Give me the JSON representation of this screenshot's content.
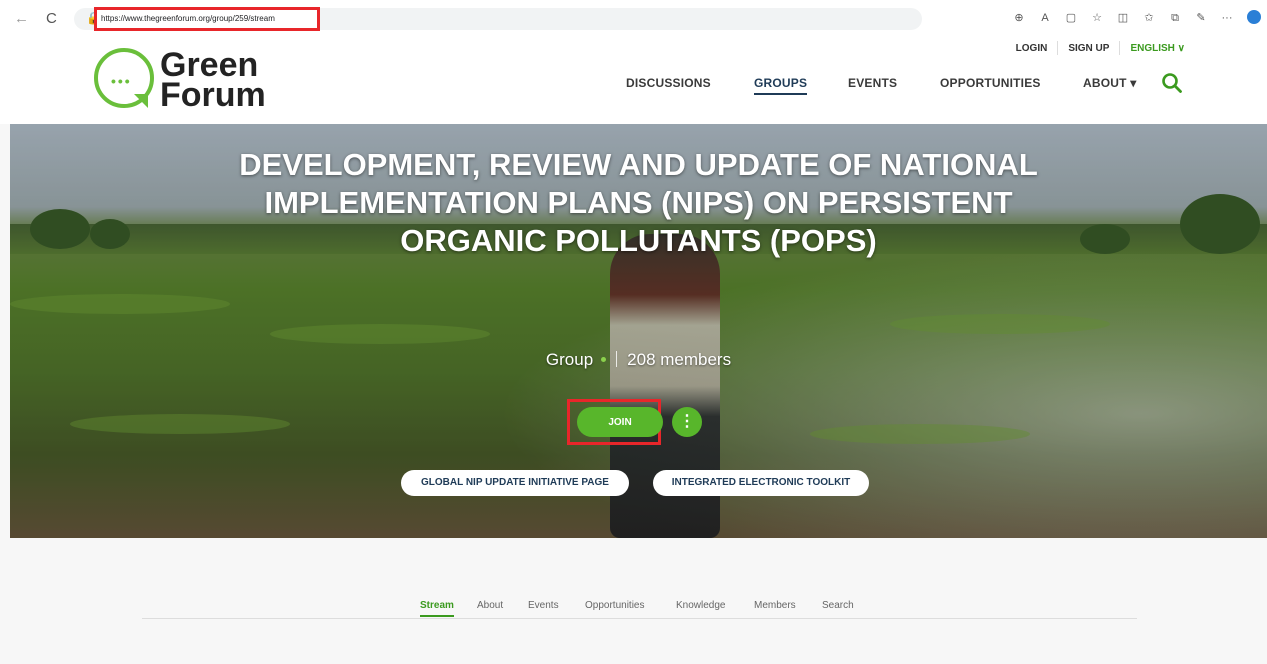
{
  "browser": {
    "url": "https://www.thegreenforum.org/group/259/stream",
    "back_icon": "←",
    "reload_icon": "C"
  },
  "header": {
    "logo_line1": "Green",
    "logo_line2": "Forum",
    "top_links": {
      "login": "LOGIN",
      "signup": "SIGN UP",
      "language": "ENGLISH ∨"
    },
    "nav": {
      "discussions": "DISCUSSIONS",
      "groups": "GROUPS",
      "events": "EVENTS",
      "opportunities": "OPPORTUNITIES",
      "about": "ABOUT ▾"
    }
  },
  "hero": {
    "title": "DEVELOPMENT, REVIEW AND UPDATE OF NATIONAL IMPLEMENTATION PLANS (NIPS) ON PERSISTENT ORGANIC POLLUTANTS (POPS)",
    "group_type": "Group",
    "members": "208 members",
    "join_label": "JOIN",
    "more_label": "⋮",
    "link1": "GLOBAL NIP UPDATE INITIATIVE PAGE",
    "link2": "INTEGRATED ELECTRONIC TOOLKIT"
  },
  "tabs": [
    "Stream",
    "About",
    "Events",
    "Opportunities",
    "Knowledge",
    "Members",
    "Search"
  ],
  "colors": {
    "brand_green": "#58b62b",
    "nav_active": "#1f3b57",
    "highlight": "#e8262a"
  }
}
